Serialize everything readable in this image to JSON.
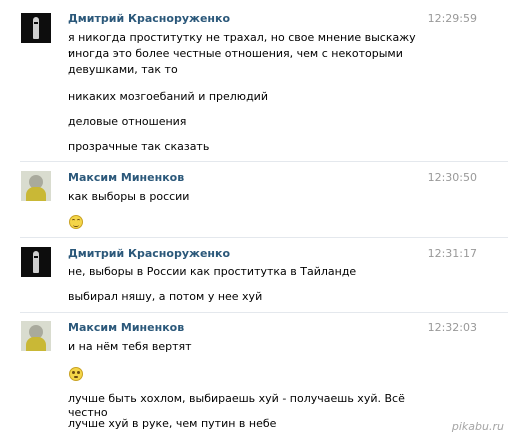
{
  "messages": [
    {
      "author": "Дмитрий Красноруженко",
      "time": "12:29:59",
      "avatar": "dark-silhouette",
      "lines": [
        "я никогда проститутку не трахал, но свое мнение выскажу -",
        "иногда это более честные отношения, чем с некоторыми",
        "девушками, так то",
        "никаких мозгоебаний и прелюдий",
        "деловые отношения",
        "прозрачные так сказать"
      ]
    },
    {
      "author": "Максим Миненков",
      "time": "12:30:50",
      "avatar": "light-figure",
      "lines": [
        "как выборы в россии"
      ],
      "emoji": "laughing-smiley-icon"
    },
    {
      "author": "Дмитрий Красноруженко",
      "time": "12:31:17",
      "avatar": "dark-silhouette",
      "lines": [
        "не, выборы в России как проститутка в Тайланде",
        "выбирал няшу, а потом у нее хуй"
      ]
    },
    {
      "author": "Максим Миненков",
      "time": "12:32:03",
      "avatar": "light-figure",
      "lines": [
        "и на нём тебя вертят"
      ],
      "emoji": "blushing-smiley-icon",
      "lines_after": [
        "лучше быть хохлом, выбираешь хуй - получаешь хуй. Всё честно",
        "лучше хуй в руке, чем путин в небе"
      ]
    }
  ],
  "watermark": "pikabu.ru"
}
